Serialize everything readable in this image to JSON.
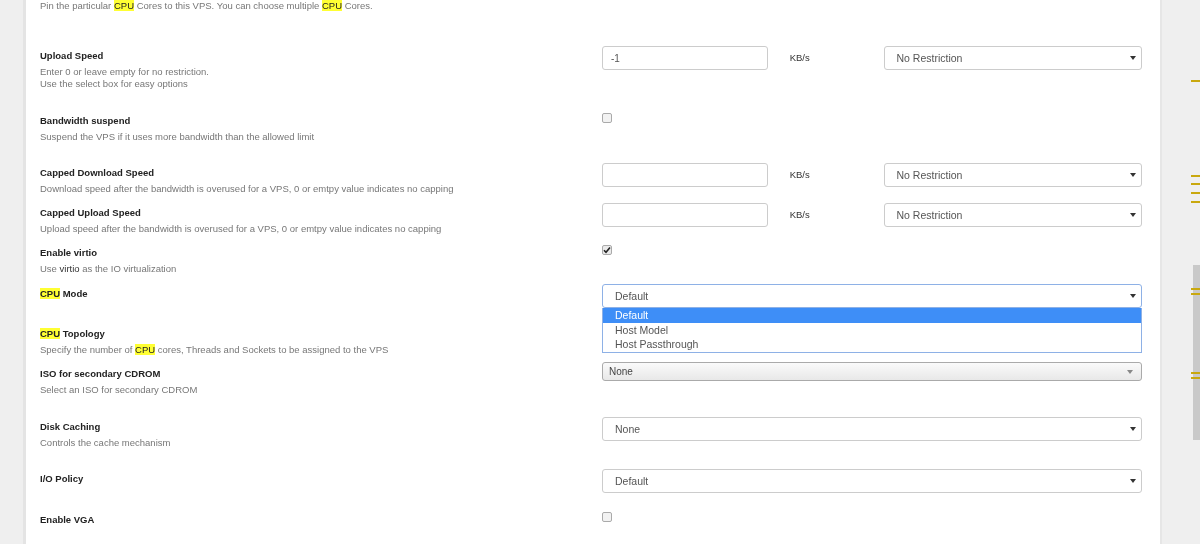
{
  "intro": [
    {
      "text": "Pin the particular ",
      "highlighted": false
    },
    {
      "text": "CPU",
      "highlighted": true
    },
    {
      "text": " Cores to this VPS. You can choose multiple ",
      "highlighted": false
    },
    {
      "text": "CPU",
      "highlighted": true
    },
    {
      "text": " Cores.",
      "highlighted": false
    }
  ],
  "rows": [
    {
      "label": [
        {
          "text": "Upload Speed",
          "highlighted": false
        }
      ],
      "description": [
        [
          {
            "text": "Enter 0 or leave empty for no restriction.",
            "highlighted": false
          }
        ],
        [
          {
            "text": "Use the select box for easy options",
            "highlighted": false
          }
        ]
      ],
      "control": {
        "kind": "rate",
        "value": "-1",
        "unit": "KB/s",
        "option": "No Restriction"
      }
    },
    {
      "label": [
        {
          "text": "Bandwidth suspend",
          "highlighted": false
        }
      ],
      "description": [
        [
          {
            "text": "Suspend the VPS if it uses more bandwidth than the allowed limit",
            "highlighted": false
          }
        ]
      ],
      "control": {
        "kind": "checkbox",
        "checked": false
      }
    },
    {
      "label": [
        {
          "text": "Capped Download Speed",
          "highlighted": false
        }
      ],
      "description": [
        [
          {
            "text": "Download speed after the bandwidth is overused for a VPS, 0 or emtpy value indicates no capping",
            "highlighted": false
          }
        ]
      ],
      "control": {
        "kind": "rate",
        "unit": "KB/s",
        "option": "No Restriction"
      }
    },
    {
      "label": [
        {
          "text": "Capped Upload Speed",
          "highlighted": false
        }
      ],
      "description": [
        [
          {
            "text": "Upload speed after the bandwidth is overused for a VPS, 0 or emtpy value indicates no capping",
            "highlighted": false
          }
        ]
      ],
      "control": {
        "kind": "rate",
        "unit": "KB/s",
        "option": "No Restriction"
      }
    },
    {
      "label": [
        {
          "text": "Enable virtio",
          "highlighted": false
        }
      ],
      "description": [
        [
          {
            "text": "Use **virtio** as the IO virtualization",
            "highlighted": false
          }
        ]
      ],
      "control": {
        "kind": "checkbox",
        "checked": true
      }
    },
    {
      "label": [
        {
          "text": "CPU",
          "highlighted": true
        },
        {
          "text": " Mode",
          "highlighted": false
        }
      ],
      "description": [],
      "control": {
        "kind": "select",
        "value": "Default",
        "expanded": true,
        "options": [
          {
            "text": "Default",
            "selected": true
          },
          {
            "text": "Host Model",
            "selected": false
          },
          {
            "text": "Host Passthrough",
            "selected": false
          }
        ]
      }
    },
    {
      "label": [
        {
          "text": "CPU",
          "highlighted": true
        },
        {
          "text": " Topology",
          "highlighted": false
        }
      ],
      "description": [
        [
          {
            "text": "Specify the number of ",
            "highlighted": false
          },
          {
            "text": "CPU",
            "highlighted": true
          },
          {
            "text": " cores, Threads and Sockets to be assigned to the VPS",
            "highlighted": false
          }
        ]
      ],
      "control": {
        "kind": "none"
      }
    },
    {
      "label": [
        {
          "text": "ISO for secondary CDROM",
          "highlighted": false
        }
      ],
      "description": [
        [
          {
            "text": "Select an ISO for secondary CDROM",
            "highlighted": false
          }
        ]
      ],
      "control": {
        "kind": "native-select",
        "value": "None"
      }
    },
    {
      "label": [
        {
          "text": "Disk Caching",
          "highlighted": false
        }
      ],
      "description": [
        [
          {
            "text": "Controls the cache mechanism",
            "highlighted": false
          }
        ]
      ],
      "control": {
        "kind": "select",
        "value": "None",
        "expanded": false
      }
    },
    {
      "label": [
        {
          "text": "I/O Policy",
          "highlighted": false
        }
      ],
      "description": [],
      "control": {
        "kind": "select",
        "value": "Default",
        "expanded": false
      }
    },
    {
      "label": [
        {
          "text": "Enable VGA",
          "highlighted": false
        }
      ],
      "description": [],
      "control": {
        "kind": "checkbox",
        "checked": false
      }
    }
  ]
}
